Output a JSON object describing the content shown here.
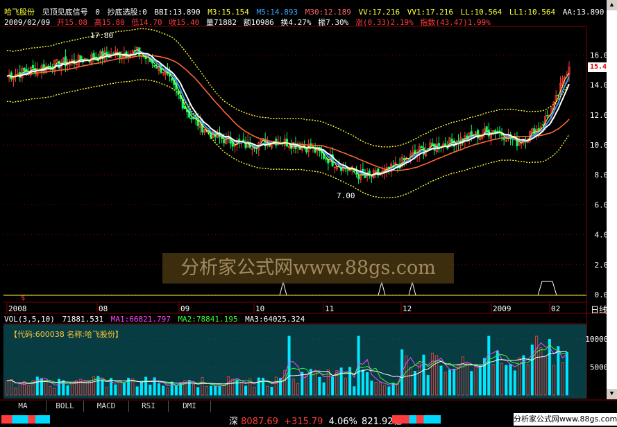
{
  "header": {
    "stock_name": "哈飞股份",
    "indicator_name": "见顶见底信号",
    "indicator_value": "0",
    "screen_name": "抄底选股",
    "screen_value": ":0",
    "bbi": "BBI:13.890",
    "m3": "M3:15.154",
    "m5": "M5:14.893",
    "m30": "M30:12.189",
    "vv": "VV:17.216",
    "vv1": "VV1:17.216",
    "ll": "LL:10.564",
    "ll1": "LL1:10.564",
    "aa": "AA:13.890"
  },
  "quote": {
    "date": "2009/02/09",
    "open": "开15.08",
    "high": "高15.80",
    "low": "低14.70",
    "close": "收15.40",
    "volume": "量71882",
    "amount": "额10986",
    "turnover": "换4.27%",
    "amplitude": "振7.30%",
    "change": "涨(0.33)2.19%",
    "index": "指数(43.47)1.99%"
  },
  "price_axis": [
    "16.00",
    "14.00",
    "12.00",
    "10.00",
    "8.00",
    "6.00",
    "4.00",
    "2.00",
    "0.00"
  ],
  "price_marks": {
    "high": "17.80",
    "low": "7.00"
  },
  "current_price": "15.40",
  "time_axis": {
    "labels": [
      "2008",
      "08",
      "09",
      "10",
      "11",
      "12",
      "2009",
      "02"
    ],
    "period": "日线"
  },
  "watermark": "分析家公式网www.88gs.com",
  "vol_header": {
    "vol": "VOL(3,5,10)",
    "vol_value": "71881.531",
    "ma1": "MA1:66821.797",
    "ma2": "MA2:78841.195",
    "ma3": "MA3:64025.324"
  },
  "code_label": "【代码:600038 名称:哈飞股份】",
  "vol_axis": [
    "100000",
    "50000",
    "0"
  ],
  "tabs": [
    "MA",
    "BOLL",
    "MACD",
    "RSI",
    "DMI"
  ],
  "status": {
    "index_name": "深",
    "index_value": "8087.69",
    "change": "+315.79",
    "pct": "4.06%",
    "amount": "821.92亿",
    "site": "分析家公式网www.88gs.com"
  },
  "colors": {
    "up": "#ff3b3b",
    "down": "#00ff66",
    "yellow": "#ffff33",
    "teal": "#0fa0a0",
    "cyan": "#00d8ff"
  }
}
